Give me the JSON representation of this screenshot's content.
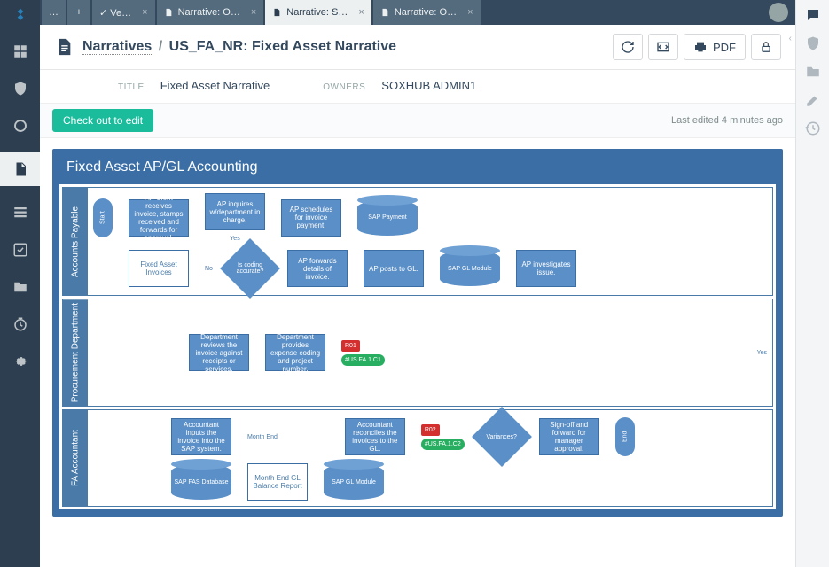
{
  "tabs": {
    "t0": "…",
    "t1": "+",
    "t2": "✓ Ve…",
    "t3": "Narrative: O…",
    "t4": "Narrative: S…",
    "t5": "Narrative: O…"
  },
  "breadcrumb": {
    "parent": "Narratives",
    "current": "US_FA_NR: Fixed Asset Narrative"
  },
  "meta": {
    "title_label": "TITLE",
    "title_value": "Fixed Asset Narrative",
    "owners_label": "OWNERS",
    "owners_value": "SOXHUB ADMIN1"
  },
  "actions": {
    "pdf": "PDF",
    "checkout": "Check out to edit",
    "last_edited": "Last edited 4 minutes ago"
  },
  "flowchart": {
    "title": "Fixed Asset AP/GL Accounting",
    "lanes": {
      "ap": "Accounts Payable",
      "proc": "Procurement Department",
      "fa": "FA Accountant"
    },
    "start": "Start",
    "end": "End",
    "ap_boxes": {
      "b1": "AP Clerk receives invoice, stamps received and forwards for approval.",
      "b2": "Fixed Asset Invoices",
      "b3": "AP inquires w/department in charge.",
      "b4": "Is coding accurate?",
      "b5": "AP schedules for invoice payment.",
      "b6": "SAP Payment",
      "b7": "AP forwards details of invoice.",
      "b8": "AP posts to GL.",
      "b9": "SAP GL Module",
      "b10": "AP investigates issue."
    },
    "proc_boxes": {
      "p1": "Department reviews the invoice against receipts or services.",
      "p2": "Department provides expense coding and project number."
    },
    "fa_boxes": {
      "f1": "Accountant inputs the invoice into the SAP system.",
      "f2": "Month End GL Balance Report",
      "f3": "SAP FAS Database",
      "f4": "Accountant reconciles the invoices to the GL.",
      "f5": "SAP GL Module",
      "f6": "Variances?",
      "f7": "Sign-off and forward for manager approval."
    },
    "annotations": {
      "no": "No",
      "yes": "Yes",
      "month_end": "Month End",
      "r01": "R01",
      "r02": "R02",
      "c1": "#US.FA.1.C1",
      "c2": "#US.FA.1.C2"
    }
  }
}
